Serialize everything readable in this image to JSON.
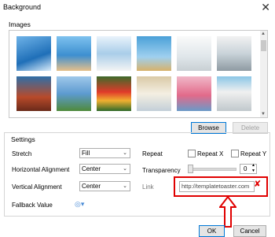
{
  "window": {
    "title": "Background",
    "close_glyph": "✕"
  },
  "images": {
    "label": "Images",
    "browse_label": "Browse",
    "delete_label": "Delete"
  },
  "settings": {
    "label": "Settings",
    "stretch": {
      "label": "Stretch",
      "value": "Fill"
    },
    "horizontal_alignment": {
      "label": "Horizontal Alignment",
      "value": "Center"
    },
    "vertical_alignment": {
      "label": "Vertical Alignment",
      "value": "Center"
    },
    "fallback_value": {
      "label": "Fallback Value"
    },
    "repeat": {
      "label": "Repeat",
      "repeat_x_label": "Repeat X",
      "repeat_y_label": "Repeat Y"
    },
    "transparency": {
      "label": "Transparency",
      "value": "0"
    },
    "link": {
      "label": "Link",
      "value": "http://templatetoaster.com",
      "clear_glyph": "✘"
    }
  },
  "footer": {
    "ok_label": "OK",
    "cancel_label": "Cancel"
  },
  "colors": {
    "highlight": "#e00000",
    "accent": "#0078d7"
  }
}
